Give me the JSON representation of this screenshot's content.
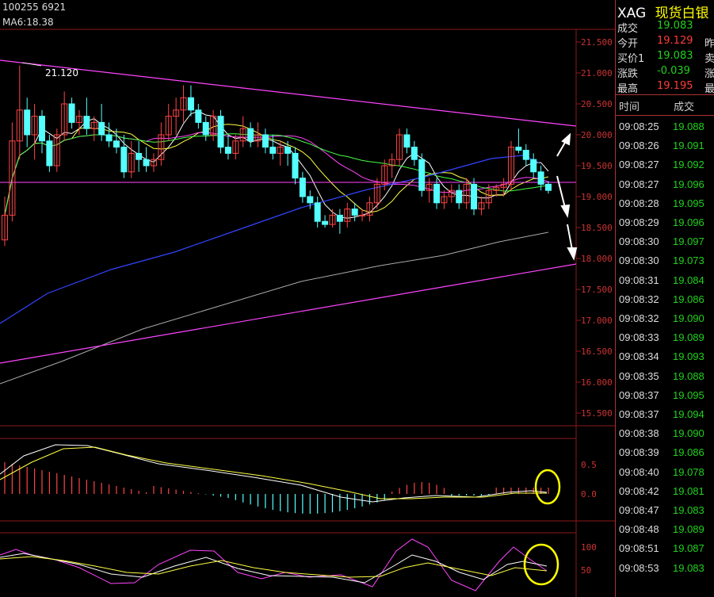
{
  "header": {
    "code_line": "100255 6921",
    "ma_line": "MA6:18.38"
  },
  "price_axis": [
    "21.500",
    "21.000",
    "20.500",
    "20.000",
    "19.500",
    "19.000",
    "18.500",
    "18.000",
    "17.500",
    "17.000",
    "16.500",
    "16.000",
    "15.500"
  ],
  "annotation": {
    "high_label": "21.120"
  },
  "macd_axis": [
    "0.5",
    "0.0"
  ],
  "kdj_axis": [
    "100",
    "50"
  ],
  "quote": {
    "symbol": "XAG",
    "name": "现货白银",
    "rows": [
      {
        "label": "成交",
        "value": "19.083",
        "value_color": "#21d11d",
        "extra": ""
      },
      {
        "label": "今开",
        "value": "19.129",
        "value_color": "#ff3b3b",
        "extra": "昨"
      },
      {
        "label": "买价1",
        "value": "19.083",
        "value_color": "#21d11d",
        "extra": "卖"
      },
      {
        "label": "涨跌",
        "value": "-0.039",
        "value_color": "#21d11d",
        "extra": "涨"
      },
      {
        "label": "最高",
        "value": "19.195",
        "value_color": "#ff3b3b",
        "extra": "最"
      }
    ]
  },
  "ticks": {
    "header_time": "时间",
    "header_price": "成交",
    "rows": [
      {
        "time": "09:08:25",
        "price": "19.088"
      },
      {
        "time": "09:08:26",
        "price": "19.091"
      },
      {
        "time": "09:08:27",
        "price": "19.092"
      },
      {
        "time": "09:08:27",
        "price": "19.096"
      },
      {
        "time": "09:08:28",
        "price": "19.095"
      },
      {
        "time": "09:08:29",
        "price": "19.096"
      },
      {
        "time": "09:08:30",
        "price": "19.097"
      },
      {
        "time": "09:08:30",
        "price": "19.073"
      },
      {
        "time": "09:08:31",
        "price": "19.084"
      },
      {
        "time": "09:08:32",
        "price": "19.086"
      },
      {
        "time": "09:08:32",
        "price": "19.090"
      },
      {
        "time": "09:08:33",
        "price": "19.089"
      },
      {
        "time": "09:08:34",
        "price": "19.093"
      },
      {
        "time": "09:08:35",
        "price": "19.088"
      },
      {
        "time": "09:08:37",
        "price": "19.095"
      },
      {
        "time": "09:08:37",
        "price": "19.094"
      },
      {
        "time": "09:08:38",
        "price": "19.090"
      },
      {
        "time": "09:08:39",
        "price": "19.086"
      },
      {
        "time": "09:08:40",
        "price": "19.078"
      },
      {
        "time": "09:08:42",
        "price": "19.081"
      },
      {
        "time": "09:08:47",
        "price": "19.083"
      },
      {
        "time": "09:08:48",
        "price": "19.089"
      },
      {
        "time": "09:08:51",
        "price": "19.087"
      },
      {
        "time": "09:08:53",
        "price": "19.083"
      }
    ]
  },
  "colors": {
    "up": "#ff4444",
    "down": "#54ffff",
    "grid": "#8b1a1a",
    "price_text": "#21d11d"
  },
  "chart_data": {
    "type": "candlestick",
    "y_range": [
      15.3,
      21.7
    ],
    "candles": [
      {
        "o": 18.3,
        "h": 19.0,
        "l": 18.2,
        "c": 18.7
      },
      {
        "o": 18.7,
        "h": 20.2,
        "l": 18.6,
        "c": 19.9
      },
      {
        "o": 19.9,
        "h": 21.12,
        "l": 19.6,
        "c": 20.4
      },
      {
        "o": 20.4,
        "h": 20.6,
        "l": 19.8,
        "c": 20.0
      },
      {
        "o": 20.0,
        "h": 20.5,
        "l": 19.6,
        "c": 20.3
      },
      {
        "o": 20.3,
        "h": 20.4,
        "l": 19.7,
        "c": 19.9
      },
      {
        "o": 19.9,
        "h": 20.0,
        "l": 19.4,
        "c": 19.5
      },
      {
        "o": 19.5,
        "h": 20.1,
        "l": 19.4,
        "c": 20.0
      },
      {
        "o": 20.0,
        "h": 20.7,
        "l": 19.9,
        "c": 20.5
      },
      {
        "o": 20.5,
        "h": 20.6,
        "l": 20.1,
        "c": 20.2
      },
      {
        "o": 20.2,
        "h": 20.4,
        "l": 20.0,
        "c": 20.3
      },
      {
        "o": 20.3,
        "h": 20.6,
        "l": 20.0,
        "c": 20.1
      },
      {
        "o": 20.1,
        "h": 20.3,
        "l": 19.9,
        "c": 20.2
      },
      {
        "o": 20.2,
        "h": 20.5,
        "l": 19.9,
        "c": 20.0
      },
      {
        "o": 20.0,
        "h": 20.2,
        "l": 19.8,
        "c": 19.9
      },
      {
        "o": 19.9,
        "h": 20.1,
        "l": 19.7,
        "c": 19.8
      },
      {
        "o": 19.8,
        "h": 20.0,
        "l": 19.3,
        "c": 19.4
      },
      {
        "o": 19.4,
        "h": 19.9,
        "l": 19.3,
        "c": 19.7
      },
      {
        "o": 19.7,
        "h": 19.9,
        "l": 19.4,
        "c": 19.6
      },
      {
        "o": 19.6,
        "h": 19.8,
        "l": 19.4,
        "c": 19.5
      },
      {
        "o": 19.5,
        "h": 19.7,
        "l": 19.4,
        "c": 19.6
      },
      {
        "o": 19.6,
        "h": 20.2,
        "l": 19.5,
        "c": 20.0
      },
      {
        "o": 20.0,
        "h": 20.5,
        "l": 19.9,
        "c": 20.3
      },
      {
        "o": 20.3,
        "h": 20.6,
        "l": 20.0,
        "c": 20.4
      },
      {
        "o": 20.4,
        "h": 20.8,
        "l": 20.2,
        "c": 20.6
      },
      {
        "o": 20.6,
        "h": 20.8,
        "l": 20.3,
        "c": 20.4
      },
      {
        "o": 20.4,
        "h": 20.5,
        "l": 20.1,
        "c": 20.2
      },
      {
        "o": 20.2,
        "h": 20.3,
        "l": 19.9,
        "c": 20.0
      },
      {
        "o": 20.0,
        "h": 20.4,
        "l": 19.9,
        "c": 20.3
      },
      {
        "o": 20.3,
        "h": 20.4,
        "l": 19.7,
        "c": 19.8
      },
      {
        "o": 19.8,
        "h": 20.0,
        "l": 19.6,
        "c": 19.7
      },
      {
        "o": 19.7,
        "h": 20.0,
        "l": 19.6,
        "c": 19.9
      },
      {
        "o": 19.9,
        "h": 20.3,
        "l": 19.8,
        "c": 20.1
      },
      {
        "o": 20.1,
        "h": 20.2,
        "l": 19.8,
        "c": 19.9
      },
      {
        "o": 19.9,
        "h": 20.2,
        "l": 19.8,
        "c": 20.0
      },
      {
        "o": 20.0,
        "h": 20.1,
        "l": 19.7,
        "c": 19.8
      },
      {
        "o": 19.8,
        "h": 20.0,
        "l": 19.6,
        "c": 19.7
      },
      {
        "o": 19.7,
        "h": 19.9,
        "l": 19.5,
        "c": 19.8
      },
      {
        "o": 19.8,
        "h": 19.9,
        "l": 19.5,
        "c": 19.7
      },
      {
        "o": 19.7,
        "h": 19.8,
        "l": 19.2,
        "c": 19.3
      },
      {
        "o": 19.3,
        "h": 19.4,
        "l": 18.9,
        "c": 19.0
      },
      {
        "o": 19.0,
        "h": 19.1,
        "l": 18.8,
        "c": 18.9
      },
      {
        "o": 18.9,
        "h": 19.0,
        "l": 18.5,
        "c": 18.6
      },
      {
        "o": 18.6,
        "h": 18.7,
        "l": 18.5,
        "c": 18.55
      },
      {
        "o": 18.55,
        "h": 18.8,
        "l": 18.5,
        "c": 18.7
      },
      {
        "o": 18.7,
        "h": 18.8,
        "l": 18.4,
        "c": 18.6
      },
      {
        "o": 18.6,
        "h": 18.9,
        "l": 18.5,
        "c": 18.8
      },
      {
        "o": 18.8,
        "h": 18.9,
        "l": 18.6,
        "c": 18.7
      },
      {
        "o": 18.7,
        "h": 18.8,
        "l": 18.6,
        "c": 18.7
      },
      {
        "o": 18.7,
        "h": 19.0,
        "l": 18.6,
        "c": 18.9
      },
      {
        "o": 18.9,
        "h": 19.3,
        "l": 18.8,
        "c": 19.2
      },
      {
        "o": 19.2,
        "h": 19.6,
        "l": 19.1,
        "c": 19.5
      },
      {
        "o": 19.5,
        "h": 19.7,
        "l": 19.3,
        "c": 19.6
      },
      {
        "o": 19.6,
        "h": 20.1,
        "l": 19.5,
        "c": 20.0
      },
      {
        "o": 20.0,
        "h": 20.1,
        "l": 19.7,
        "c": 19.8
      },
      {
        "o": 19.8,
        "h": 19.9,
        "l": 19.5,
        "c": 19.6
      },
      {
        "o": 19.6,
        "h": 19.7,
        "l": 19.0,
        "c": 19.1
      },
      {
        "o": 19.1,
        "h": 19.3,
        "l": 18.9,
        "c": 19.2
      },
      {
        "o": 19.2,
        "h": 19.3,
        "l": 18.8,
        "c": 18.9
      },
      {
        "o": 18.9,
        "h": 19.1,
        "l": 18.8,
        "c": 19.0
      },
      {
        "o": 19.0,
        "h": 19.2,
        "l": 18.9,
        "c": 19.1
      },
      {
        "o": 19.1,
        "h": 19.2,
        "l": 18.8,
        "c": 18.9
      },
      {
        "o": 18.9,
        "h": 19.3,
        "l": 18.8,
        "c": 19.2
      },
      {
        "o": 19.2,
        "h": 19.3,
        "l": 18.7,
        "c": 18.8
      },
      {
        "o": 18.8,
        "h": 19.0,
        "l": 18.7,
        "c": 18.9
      },
      {
        "o": 18.9,
        "h": 19.2,
        "l": 18.8,
        "c": 19.1
      },
      {
        "o": 19.1,
        "h": 19.2,
        "l": 19.0,
        "c": 19.15
      },
      {
        "o": 19.15,
        "h": 19.3,
        "l": 19.0,
        "c": 19.2
      },
      {
        "o": 19.2,
        "h": 19.9,
        "l": 19.1,
        "c": 19.8
      },
      {
        "o": 19.8,
        "h": 20.1,
        "l": 19.7,
        "c": 19.75
      },
      {
        "o": 19.75,
        "h": 19.85,
        "l": 19.5,
        "c": 19.6
      },
      {
        "o": 19.6,
        "h": 19.7,
        "l": 19.3,
        "c": 19.4
      },
      {
        "o": 19.4,
        "h": 19.5,
        "l": 19.1,
        "c": 19.2
      },
      {
        "o": 19.2,
        "h": 19.25,
        "l": 19.05,
        "c": 19.1
      }
    ]
  }
}
